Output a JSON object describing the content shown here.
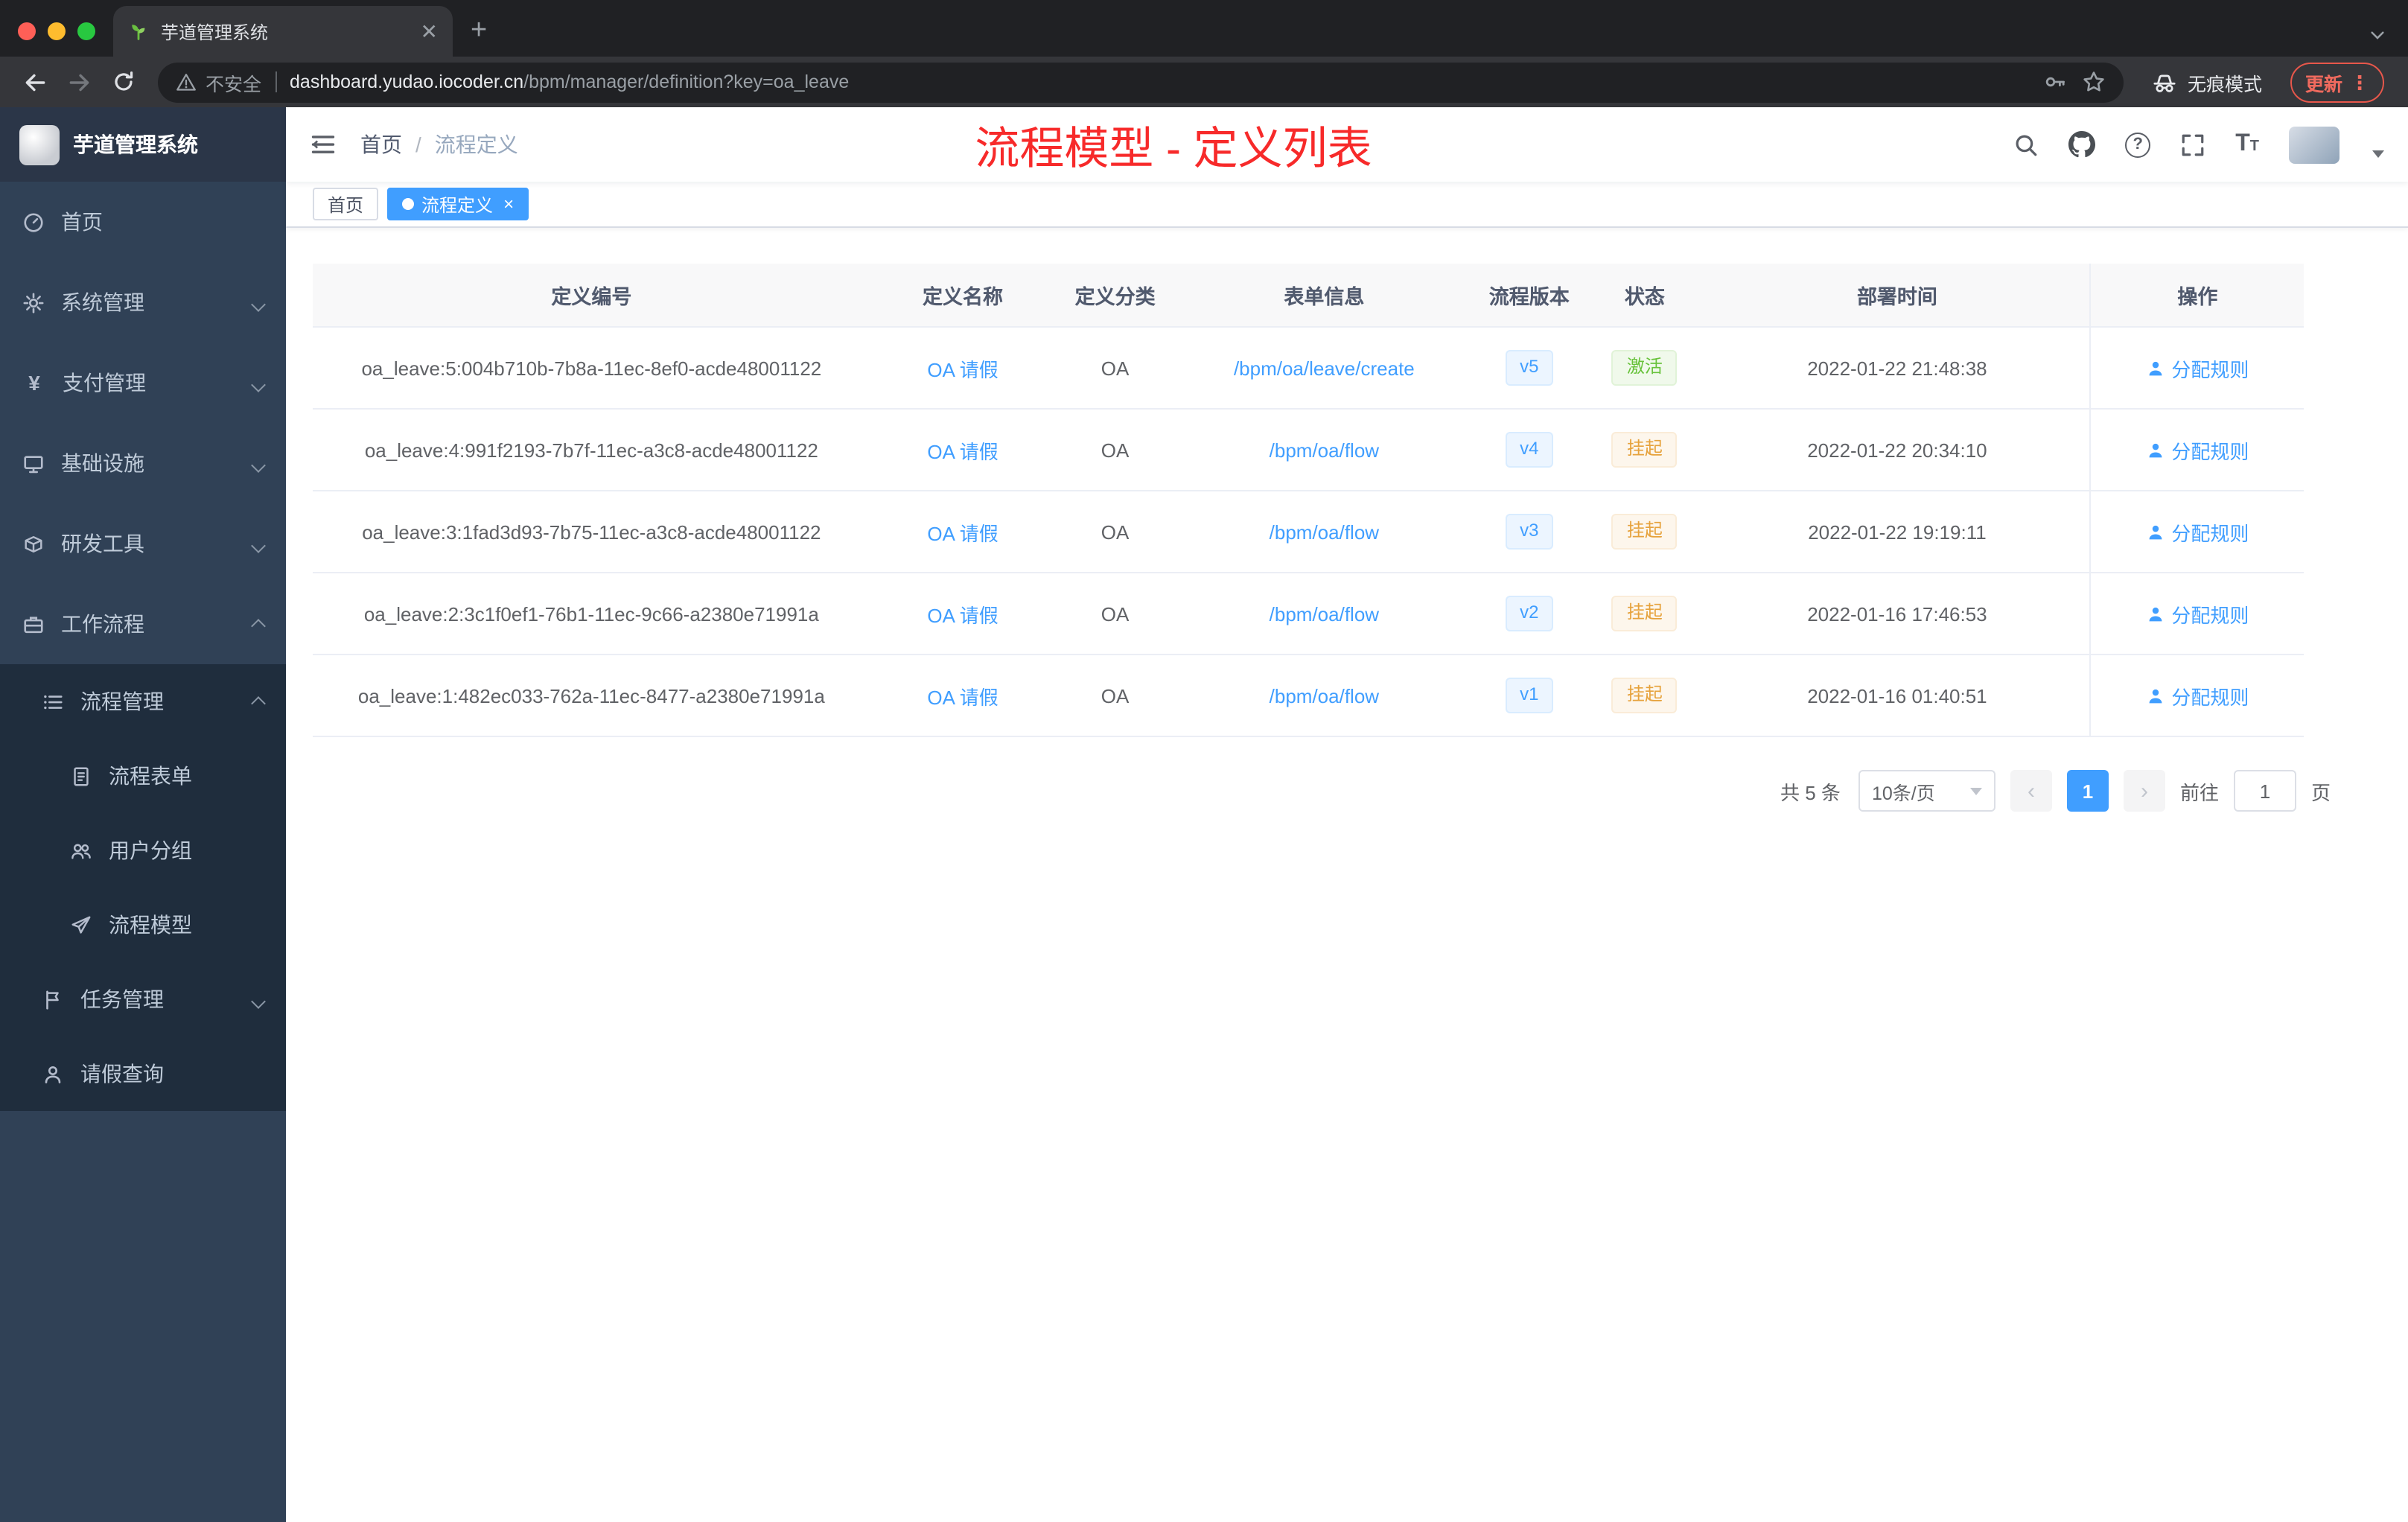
{
  "colors": {
    "accent": "#409eff",
    "success": "#67c23a",
    "warning": "#e6a23c",
    "overlay_title_red": "#f72a2a",
    "sidebar_bg": "#304156",
    "submenu_bg": "#1f2d3d"
  },
  "browser": {
    "tab_title": "芋道管理系统",
    "new_tab": "+",
    "security_label": "不安全",
    "url_host": "dashboard.yudao.iocoder.cn",
    "url_path": "/bpm/manager/definition?key=oa_leave",
    "incognito_label": "无痕模式",
    "update_label": "更新",
    "menu_dots": "⋮"
  },
  "sidebar": {
    "logo_title": "芋道管理系统",
    "items": [
      {
        "label": "首页",
        "icon": "dashboard-icon"
      },
      {
        "label": "系统管理",
        "icon": "gear-icon"
      },
      {
        "label": "支付管理",
        "icon": "yen-icon"
      },
      {
        "label": "基础设施",
        "icon": "server-icon"
      },
      {
        "label": "研发工具",
        "icon": "cube-icon"
      },
      {
        "label": "工作流程",
        "icon": "briefcase-icon"
      },
      {
        "label": "流程管理",
        "icon": "list-icon"
      },
      {
        "label": "流程表单",
        "icon": "document-icon"
      },
      {
        "label": "用户分组",
        "icon": "users-icon"
      },
      {
        "label": "流程模型",
        "icon": "paper-plane-icon"
      },
      {
        "label": "任务管理",
        "icon": "flag-icon"
      },
      {
        "label": "请假查询",
        "icon": "person-icon"
      }
    ]
  },
  "header": {
    "breadcrumb": {
      "home": "首页",
      "separator": "/",
      "current": "流程定义"
    },
    "overlay_title": "流程模型 - 定义列表",
    "icons": [
      "search-icon",
      "github-icon",
      "help-icon",
      "fullscreen-icon",
      "font-size-icon",
      "avatar"
    ]
  },
  "tags": {
    "home": "首页",
    "active": "流程定义",
    "close": "×"
  },
  "table": {
    "columns": [
      "定义编号",
      "定义名称",
      "定义分类",
      "表单信息",
      "流程版本",
      "状态",
      "部署时间",
      "操作"
    ],
    "rows": [
      {
        "id": "oa_leave:5:004b710b-7b8a-11ec-8ef0-acde48001122",
        "name": "OA 请假",
        "category": "OA",
        "form": "/bpm/oa/leave/create",
        "version": "v5",
        "status": "激活",
        "time": "2022-01-22 21:48:38",
        "action": "分配规则"
      },
      {
        "id": "oa_leave:4:991f2193-7b7f-11ec-a3c8-acde48001122",
        "name": "OA 请假",
        "category": "OA",
        "form": "/bpm/oa/flow",
        "version": "v4",
        "status": "挂起",
        "time": "2022-01-22 20:34:10",
        "action": "分配规则"
      },
      {
        "id": "oa_leave:3:1fad3d93-7b75-11ec-a3c8-acde48001122",
        "name": "OA 请假",
        "category": "OA",
        "form": "/bpm/oa/flow",
        "version": "v3",
        "status": "挂起",
        "time": "2022-01-22 19:19:11",
        "action": "分配规则"
      },
      {
        "id": "oa_leave:2:3c1f0ef1-76b1-11ec-9c66-a2380e71991a",
        "name": "OA 请假",
        "category": "OA",
        "form": "/bpm/oa/flow",
        "version": "v2",
        "status": "挂起",
        "time": "2022-01-16 17:46:53",
        "action": "分配规则"
      },
      {
        "id": "oa_leave:1:482ec033-762a-11ec-8477-a2380e71991a",
        "name": "OA 请假",
        "category": "OA",
        "form": "/bpm/oa/flow",
        "version": "v1",
        "status": "挂起",
        "time": "2022-01-16 01:40:51",
        "action": "分配规则"
      }
    ]
  },
  "pagination": {
    "total": "共 5 条",
    "page_size": "10条/页",
    "prev": "‹",
    "next": "›",
    "page": "1",
    "goto_label": "前往",
    "goto_value": "1",
    "unit": "页"
  }
}
